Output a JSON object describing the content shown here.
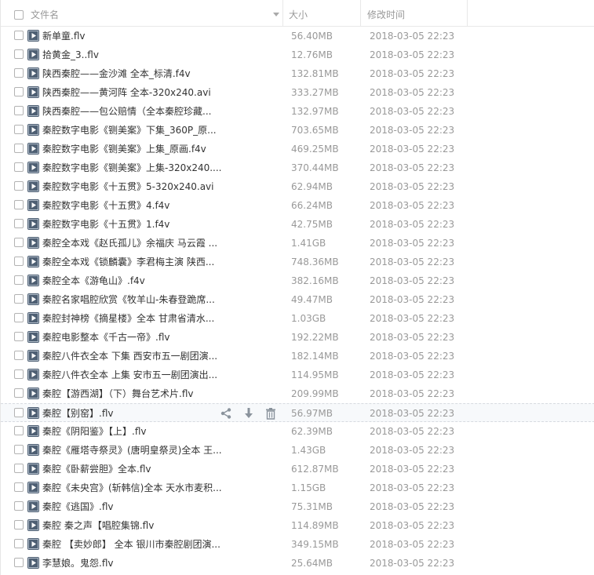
{
  "header": {
    "name_label": "文件名",
    "size_label": "大小",
    "date_label": "修改时间"
  },
  "icons": {
    "file_icon": "video-file-icon",
    "share": "share-icon",
    "download": "download-icon",
    "delete": "trash-icon"
  },
  "hover_row_index": 20,
  "files": [
    {
      "name": "新单童.flv",
      "size": "56.40MB",
      "date": "2018-03-05 22:23"
    },
    {
      "name": "拾黄金_3..flv",
      "size": "12.76MB",
      "date": "2018-03-05 22:23"
    },
    {
      "name": "陕西秦腔——金沙滩  全本_标清.f4v",
      "size": "132.81MB",
      "date": "2018-03-05 22:23"
    },
    {
      "name": "陕西秦腔——黄河阵  全本-320x240.avi",
      "size": "333.27MB",
      "date": "2018-03-05 22:23"
    },
    {
      "name": "陕西秦腔——包公赔情（全本秦腔珍藏...",
      "size": "132.97MB",
      "date": "2018-03-05 22:23"
    },
    {
      "name": "秦腔数字电影《铡美案》下集_360P_原...",
      "size": "703.65MB",
      "date": "2018-03-05 22:23"
    },
    {
      "name": "秦腔数字电影《铡美案》上集_原画.f4v",
      "size": "469.25MB",
      "date": "2018-03-05 22:23"
    },
    {
      "name": "秦腔数字电影《铡美案》上集-320x240....",
      "size": "370.44MB",
      "date": "2018-03-05 22:23"
    },
    {
      "name": "秦腔数字电影《十五贯》5-320x240.avi",
      "size": "62.94MB",
      "date": "2018-03-05 22:23"
    },
    {
      "name": "秦腔数字电影《十五贯》4.f4v",
      "size": "66.24MB",
      "date": "2018-03-05 22:23"
    },
    {
      "name": "秦腔数字电影《十五贯》1.f4v",
      "size": "42.75MB",
      "date": "2018-03-05 22:23"
    },
    {
      "name": "秦腔全本戏《赵氏孤儿》余福庆 马云霞 ...",
      "size": "1.41GB",
      "date": "2018-03-05 22:23"
    },
    {
      "name": "秦腔全本戏《锁麟囊》李君梅主演 陕西...",
      "size": "748.36MB",
      "date": "2018-03-05 22:23"
    },
    {
      "name": "秦腔全本《游龟山》.f4v",
      "size": "382.16MB",
      "date": "2018-03-05 22:23"
    },
    {
      "name": "秦腔名家唱腔欣赏《牧羊山-朱春登跪席...",
      "size": "49.47MB",
      "date": "2018-03-05 22:23"
    },
    {
      "name": "秦腔封神榜《摘星楼》全本 甘肃省清水...",
      "size": "1.03GB",
      "date": "2018-03-05 22:23"
    },
    {
      "name": "秦腔电影整本《千古一帝》.flv",
      "size": "192.22MB",
      "date": "2018-03-05 22:23"
    },
    {
      "name": "秦腔八件衣全本 下集  西安市五一剧团演...",
      "size": "182.14MB",
      "date": "2018-03-05 22:23"
    },
    {
      "name": "秦腔八件衣全本 上集 安市五一剧团演出...",
      "size": "114.95MB",
      "date": "2018-03-05 22:23"
    },
    {
      "name": "秦腔【游西湖】（下）舞台艺术片.flv",
      "size": "209.99MB",
      "date": "2018-03-05 22:23"
    },
    {
      "name": "秦腔【别窑】.flv",
      "size": "56.97MB",
      "date": "2018-03-05 22:23"
    },
    {
      "name": "秦腔《阴阳鉴》【上】.flv",
      "size": "62.39MB",
      "date": "2018-03-05 22:23"
    },
    {
      "name": "秦腔《雁塔寺祭灵》(唐明皇祭灵)全本 王...",
      "size": "1.43GB",
      "date": "2018-03-05 22:23"
    },
    {
      "name": "秦腔《卧薪尝胆》全本.flv",
      "size": "612.87MB",
      "date": "2018-03-05 22:23"
    },
    {
      "name": "秦腔《未央宫》(斩韩信)全本 天水市麦积...",
      "size": "1.15GB",
      "date": "2018-03-05 22:23"
    },
    {
      "name": "秦腔《逃国》.flv",
      "size": "75.31MB",
      "date": "2018-03-05 22:23"
    },
    {
      "name": "秦腔 秦之声【唱腔集锦.flv",
      "size": "114.89MB",
      "date": "2018-03-05 22:23"
    },
    {
      "name": "秦腔 【卖妙郎】 全本 银川市秦腔剧团演...",
      "size": "349.15MB",
      "date": "2018-03-05 22:23"
    },
    {
      "name": "李慧娘。鬼怨.flv",
      "size": "25.64MB",
      "date": "2018-03-05 22:23"
    }
  ]
}
